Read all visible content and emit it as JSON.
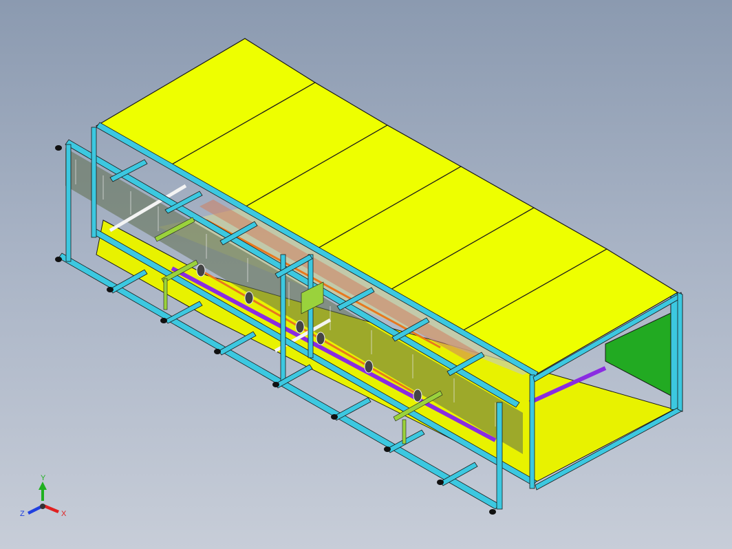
{
  "viewport": {
    "background_top": "#8b9ab0",
    "background_bottom": "#c7cdd8"
  },
  "colors": {
    "roof_panel": "#eeff00",
    "floor_panel": "#e8f200",
    "frame_beam": "#3cc8e0",
    "end_wall": "#22aa22",
    "rail_orange": "#e8781e",
    "rail_purple": "#8a2be2",
    "bracket_green": "#9ad23c",
    "grate": "#4a5a3a",
    "edge": "#1a1a1a"
  },
  "triad": {
    "x_label": "X",
    "y_label": "Y",
    "z_label": "Z",
    "x_color": "#e02020",
    "y_color": "#20b020",
    "z_color": "#2040e0"
  },
  "model": {
    "name": "enclosed-conveyor-frame",
    "roof_panel_count": 6
  }
}
